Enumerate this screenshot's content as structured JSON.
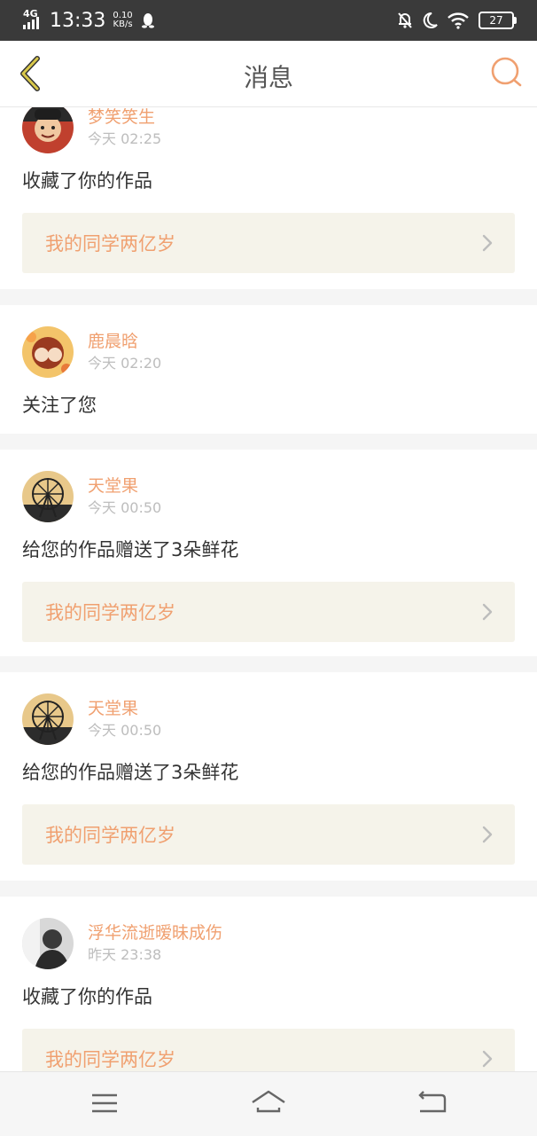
{
  "status_bar": {
    "network": "4G",
    "time": "13:33",
    "speed_value": "0.10",
    "speed_unit": "KB/s",
    "battery": "27",
    "icons": [
      "qq-penguin-icon",
      "notifications-off-icon",
      "moon-icon",
      "wifi-icon",
      "battery-icon"
    ]
  },
  "header": {
    "title": "消息",
    "back_icon": "chevron-left-icon",
    "search_icon": "search-icon"
  },
  "messages": [
    {
      "user": "梦笑笑生",
      "time": "今天 02:25",
      "action": "收藏了你的作品",
      "work": "我的同学两亿岁"
    },
    {
      "user": "鹿晨晗",
      "time": "今天 02:20",
      "action": "关注了您",
      "work": null
    },
    {
      "user": "天堂果",
      "time": "今天 00:50",
      "action": "给您的作品赠送了3朵鲜花",
      "work": "我的同学两亿岁"
    },
    {
      "user": "天堂果",
      "time": "今天 00:50",
      "action": "给您的作品赠送了3朵鲜花",
      "work": "我的同学两亿岁"
    },
    {
      "user": "浮华流逝暧昧成伤",
      "time": "昨天 23:38",
      "action": "收藏了你的作品",
      "work": "我的同学两亿岁"
    }
  ],
  "nav_bar": {
    "icons": [
      "menu-icon",
      "home-icon",
      "back-icon"
    ]
  },
  "colors": {
    "accent": "#f0a070",
    "link_background": "#f5f3ea",
    "status_bar": "#3a3a3a"
  }
}
